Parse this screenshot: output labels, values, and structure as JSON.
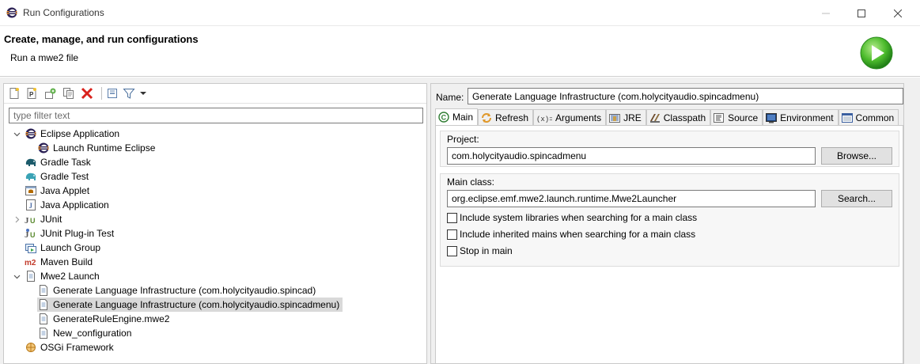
{
  "window": {
    "title": "Run Configurations",
    "controls": [
      "minimize",
      "maximize",
      "close"
    ]
  },
  "header": {
    "heading": "Create, manage, and run configurations",
    "subheading": "Run a mwe2 file"
  },
  "toolbar": {
    "buttons": [
      "new-configuration-icon",
      "new-prototype-icon",
      "export-icon",
      "duplicate-icon",
      "delete-icon",
      "collapse-all-icon",
      "filter-icon",
      "dropdown-arrow-icon"
    ]
  },
  "filter": {
    "placeholder": "type filter text",
    "value": ""
  },
  "tree": {
    "items": [
      {
        "label": "Eclipse Application",
        "icon": "eclipse-icon",
        "expanded": true
      },
      {
        "label": "Launch Runtime Eclipse",
        "icon": "eclipse-icon"
      },
      {
        "label": "Gradle Task",
        "icon": "gradle-elephant-icon"
      },
      {
        "label": "Gradle Test",
        "icon": "gradle-test-icon"
      },
      {
        "label": "Java Applet",
        "icon": "java-applet-icon"
      },
      {
        "label": "Java Application",
        "icon": "java-application-icon"
      },
      {
        "label": "JUnit",
        "icon": "junit-icon",
        "expanded": false
      },
      {
        "label": "JUnit Plug-in Test",
        "icon": "junit-plugin-icon"
      },
      {
        "label": "Launch Group",
        "icon": "launch-group-icon"
      },
      {
        "label": "Maven Build",
        "icon": "maven-icon"
      },
      {
        "label": "Mwe2 Launch",
        "icon": "mwe2-icon",
        "expanded": true
      },
      {
        "label": "Generate Language Infrastructure (com.holycityaudio.spincad)",
        "icon": "document-icon"
      },
      {
        "label": "Generate Language Infrastructure (com.holycityaudio.spincadmenu)",
        "icon": "document-icon",
        "selected": true
      },
      {
        "label": "GenerateRuleEngine.mwe2",
        "icon": "document-icon"
      },
      {
        "label": "New_configuration",
        "icon": "document-icon"
      },
      {
        "label": "OSGi Framework",
        "icon": "osgi-icon"
      }
    ]
  },
  "config": {
    "name_label": "Name:",
    "name_value": "Generate Language Infrastructure (com.holycityaudio.spincadmenu)",
    "tabs": [
      {
        "label": "Main",
        "icon": "main-tab-icon",
        "active": true
      },
      {
        "label": "Refresh",
        "icon": "refresh-icon"
      },
      {
        "label": "Arguments",
        "icon": "arguments-icon"
      },
      {
        "label": "JRE",
        "icon": "jre-icon"
      },
      {
        "label": "Classpath",
        "icon": "classpath-icon"
      },
      {
        "label": "Source",
        "icon": "source-icon"
      },
      {
        "label": "Environment",
        "icon": "environment-icon"
      },
      {
        "label": "Common",
        "icon": "common-icon"
      }
    ],
    "project": {
      "label": "Project:",
      "value": "com.holycityaudio.spincadmenu",
      "button": "Browse..."
    },
    "main_class": {
      "label": "Main class:",
      "value": "org.eclipse.emf.mwe2.launch.runtime.Mwe2Launcher",
      "button": "Search..."
    },
    "options": [
      {
        "label": "Include system libraries when searching for a main class",
        "checked": false
      },
      {
        "label": "Include inherited mains when searching for a main class",
        "checked": false
      },
      {
        "label": "Stop in main",
        "checked": false
      }
    ]
  },
  "colors": {
    "selection": "#d9d9d9",
    "run_green": "#3cae2c",
    "delete_red": "#d9221c"
  }
}
